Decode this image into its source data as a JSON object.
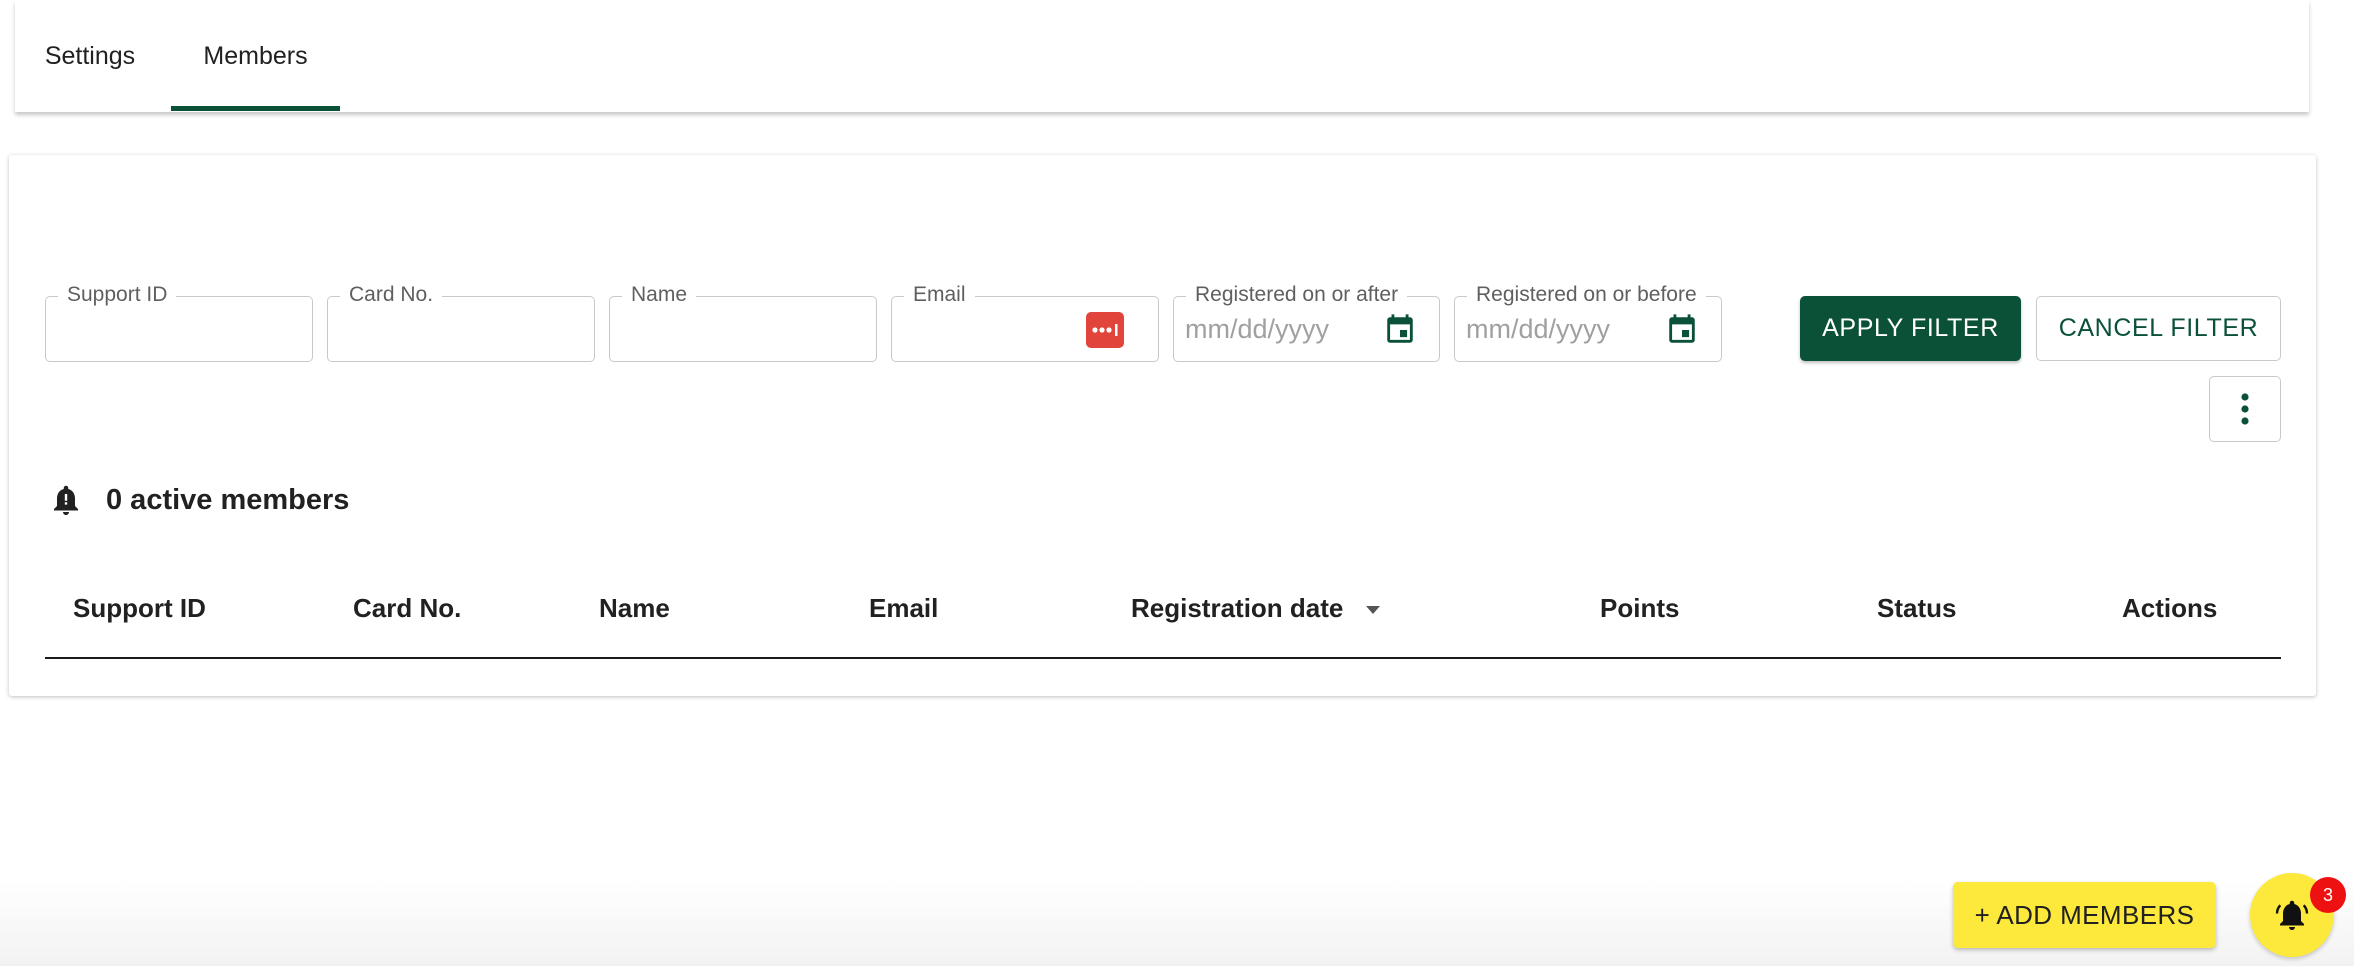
{
  "tabs": [
    {
      "label": "Settings",
      "active": false
    },
    {
      "label": "Members",
      "active": true
    }
  ],
  "filters": {
    "support_id": {
      "label": "Support ID",
      "value": ""
    },
    "card_no": {
      "label": "Card No.",
      "value": ""
    },
    "name": {
      "label": "Name",
      "value": ""
    },
    "email": {
      "label": "Email",
      "value": "",
      "icon": "password-manager-icon"
    },
    "registered_after": {
      "label": "Registered on or after",
      "placeholder": "mm/dd/yyyy",
      "icon": "calendar-icon"
    },
    "registered_before": {
      "label": "Registered on or before",
      "placeholder": "mm/dd/yyyy",
      "icon": "calendar-icon"
    },
    "apply_label": "APPLY FILTER",
    "cancel_label": "CANCEL FILTER",
    "more_icon": "more-vert-icon"
  },
  "summary": {
    "icon": "bell-icon",
    "text": "0 active members"
  },
  "table": {
    "columns": [
      "Support ID",
      "Card No.",
      "Name",
      "Email",
      "Registration date",
      "Points",
      "Status",
      "Actions"
    ],
    "sort_icon": "arrow-drop-down-icon",
    "rows": []
  },
  "actions": {
    "add_members_label": "+ ADD MEMBERS",
    "notification_icon": "ringing-bell-icon",
    "notification_count": "3"
  },
  "colors": {
    "primary": "#0b5138",
    "accent": "#fde93c",
    "badge": "#ee1111",
    "password_icon": "#e0443b"
  }
}
